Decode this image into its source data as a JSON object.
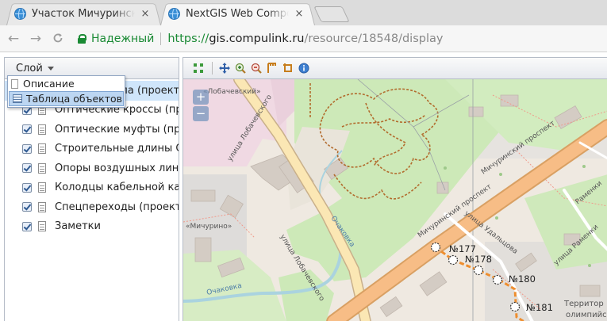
{
  "browser": {
    "tabs": [
      {
        "title": "Участок Мичуринск",
        "close": "×",
        "active": false
      },
      {
        "title": "NextGIS Web Compo",
        "close": "×",
        "active": true
      }
    ],
    "nav": {
      "back": "←",
      "forward": "→",
      "reload": "C"
    },
    "security_label": "Надежный",
    "url": {
      "scheme": "https://",
      "host": "gis.compulink.ru",
      "path": "/resource/18548/display"
    }
  },
  "layers_panel": {
    "header_label": "Слой",
    "menu": [
      {
        "label": "Описание",
        "icon": "document-icon"
      },
      {
        "label": "Таблица объектов",
        "icon": "table-icon",
        "highlighted": true
      }
    ],
    "items": [
      {
        "label": "Точки доступа (проект)",
        "checked": true,
        "selected": true
      },
      {
        "label": "Оптические кроссы (проект)",
        "checked": true
      },
      {
        "label": "Оптические муфты (проект)",
        "checked": true
      },
      {
        "label": "Строительные длины ОК (проект)",
        "checked": true
      },
      {
        "label": "Опоры воздушных линий",
        "checked": true
      },
      {
        "label": "Колодцы кабельной канализации",
        "checked": true
      },
      {
        "label": "Спецпереходы (проект)",
        "checked": true
      },
      {
        "label": "Заметки",
        "checked": true
      }
    ]
  },
  "map_toolbar": {
    "icons": [
      "zoom-extent-icon",
      "pan-icon",
      "zoom-in-icon",
      "zoom-out-icon",
      "measure-length-icon",
      "measure-area-icon",
      "identify-icon"
    ]
  },
  "map": {
    "zoom_in": "+",
    "zoom_out": "−",
    "labels": {
      "lobachevskogo_top": "улица Лобачевского",
      "lobachevskogo_bottom": "улица Лобачевского",
      "michurinsky_1": "Мичуринский проспект",
      "michurinsky_2": "Мичуринский проспект",
      "udaltsova": "улица Удальцова",
      "ochakovka_1": "Очаковка",
      "ochakovka_2": "Очаковка",
      "michurino": "«Мичурино»",
      "lobachevsky_park": "«Лобачевский»",
      "ramenki_1": "Раменки",
      "ramenki_2": "улица Раменки",
      "territory": "Территор",
      "olympic": "олимпийск"
    },
    "points": [
      {
        "label": "№177"
      },
      {
        "label": "№178"
      },
      {
        "label": "№180"
      },
      {
        "label": "№181"
      }
    ],
    "colors": {
      "green": "#cde9b8",
      "road": "#f5bd8b",
      "residential": "#e0dfdf",
      "water": "#aad3df"
    }
  }
}
